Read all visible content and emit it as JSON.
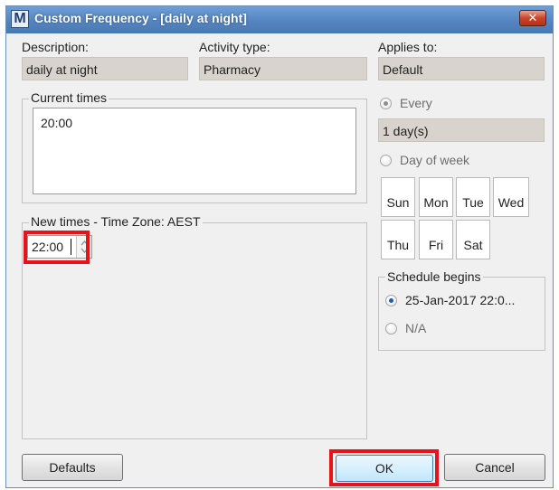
{
  "window": {
    "app_icon_letter": "M",
    "title": "Custom Frequency - [daily at night]",
    "close_glyph": "✕"
  },
  "fields": {
    "description_label": "Description:",
    "description_value": "daily at night",
    "activity_type_label": "Activity type:",
    "activity_type_value": "Pharmacy",
    "applies_to_label": "Applies to:",
    "applies_to_value": "Default"
  },
  "current_times": {
    "legend": "Current times",
    "values": [
      "20:00"
    ]
  },
  "new_times": {
    "legend": "New times - Time Zone: AEST",
    "input_value": "22:00"
  },
  "frequency": {
    "every_label": "Every",
    "every_value": "1 day(s)",
    "day_of_week_label": "Day of week",
    "days_row1": [
      "Sun",
      "Mon",
      "Tue",
      "Wed"
    ],
    "days_row2": [
      "Thu",
      "Fri",
      "Sat"
    ]
  },
  "schedule": {
    "legend": "Schedule begins",
    "begin_value": "25-Jan-2017  22:0...",
    "na_label": "N/A"
  },
  "buttons": {
    "defaults": "Defaults",
    "ok": "OK",
    "cancel": "Cancel"
  },
  "colors": {
    "titlebar": "#5585c0",
    "highlight": "#e8121b",
    "readonly_bg": "#d8d4cd"
  }
}
